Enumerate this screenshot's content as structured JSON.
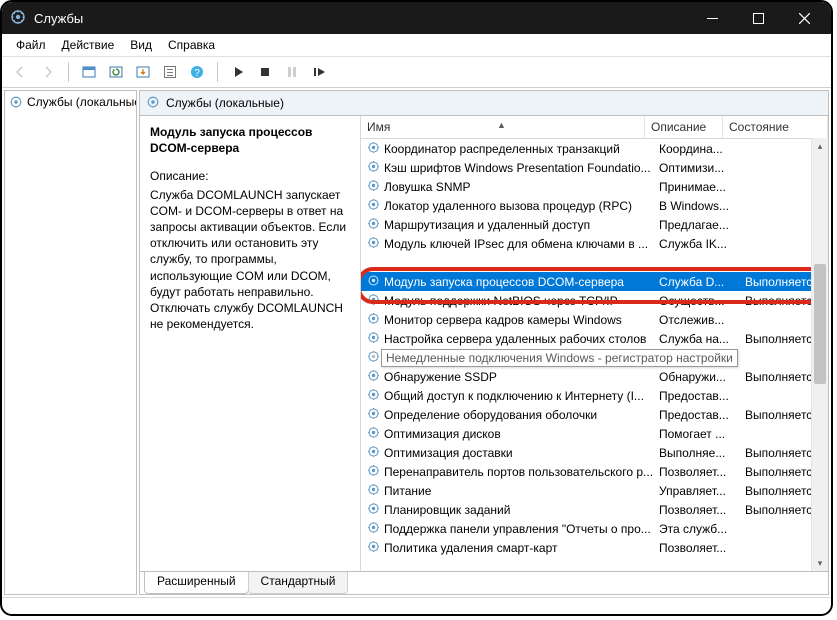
{
  "window": {
    "title": "Службы"
  },
  "menu": {
    "file": "Файл",
    "action": "Действие",
    "view": "Вид",
    "help": "Справка"
  },
  "sidebar": {
    "label": "Службы (локальные)"
  },
  "main_header": "Службы (локальные)",
  "detail": {
    "title": "Модуль запуска процессов DCOM-сервера",
    "desc_label": "Описание:",
    "desc_body": "Служба DCOMLAUNCH запускает COM- и DCOM-серверы в ответ на запросы активации объектов. Если отключить или остановить эту службу, то программы, использующие COM или DCOM, будут работать неправильно. Отключать службу DCOMLAUNCH не рекомендуется."
  },
  "columns": {
    "name": "Имя",
    "desc": "Описание",
    "state": "Состояние"
  },
  "rows": [
    {
      "name": "Координатор распределенных транзакций",
      "desc": "Координа...",
      "state": ""
    },
    {
      "name": "Кэш шрифтов Windows Presentation Foundatio...",
      "desc": "Оптимизи...",
      "state": ""
    },
    {
      "name": "Ловушка SNMP",
      "desc": "Принимае...",
      "state": ""
    },
    {
      "name": "Локатор удаленного вызова процедур (RPC)",
      "desc": "В Windows...",
      "state": ""
    },
    {
      "name": "Маршрутизация и удаленный доступ",
      "desc": "Предлагае...",
      "state": ""
    },
    {
      "name": "Модуль ключей IPsec для обмена ключами в ...",
      "desc": "Служба IK...",
      "state": ""
    },
    {
      "name": "",
      "desc": "",
      "state": ""
    },
    {
      "name": "",
      "desc": "",
      "state": ""
    },
    {
      "name": "Модуль поддержки NetBIOS через TCP/IP",
      "desc": "Осуществ...",
      "state": "Выполняетс"
    },
    {
      "name": "Монитор сервера кадров камеры Windows",
      "desc": "Отслежив...",
      "state": ""
    },
    {
      "name": "Настройка сервера удаленных рабочих столов",
      "desc": "Служба на...",
      "state": "Выполняетс"
    },
    {
      "name": "Немедленные подключения Windows - регист...",
      "desc": "",
      "state": "",
      "dimmed": true
    },
    {
      "name": "Обнаружение SSDP",
      "desc": "Обнаружи...",
      "state": "Выполняетс"
    },
    {
      "name": "Общий доступ к подключению к Интернету (I...",
      "desc": "Предостав...",
      "state": ""
    },
    {
      "name": "Определение оборудования оболочки",
      "desc": "Предостав...",
      "state": "Выполняетс"
    },
    {
      "name": "Оптимизация дисков",
      "desc": "Помогает ...",
      "state": ""
    },
    {
      "name": "Оптимизация доставки",
      "desc": "Выполняе...",
      "state": "Выполняетс"
    },
    {
      "name": "Перенаправитель портов пользовательского р...",
      "desc": "Позволяет...",
      "state": "Выполняетс"
    },
    {
      "name": "Питание",
      "desc": "Управляет...",
      "state": "Выполняетс"
    },
    {
      "name": "Планировщик заданий",
      "desc": "Позволяет...",
      "state": "Выполняетс"
    },
    {
      "name": "Поддержка панели управления \"Отчеты о про...",
      "desc": "Эта служб...",
      "state": ""
    },
    {
      "name": "Политика удаления смарт-карт",
      "desc": "Позволяет...",
      "state": ""
    }
  ],
  "selected": {
    "name": "Модуль запуска процессов DCOM-сервера",
    "desc": "Служба D...",
    "state": "Выполняетс"
  },
  "tooltip": "Немедленные подключения Windows - регистратор настройки",
  "tabs": {
    "extended": "Расширенный",
    "standard": "Стандартный"
  }
}
